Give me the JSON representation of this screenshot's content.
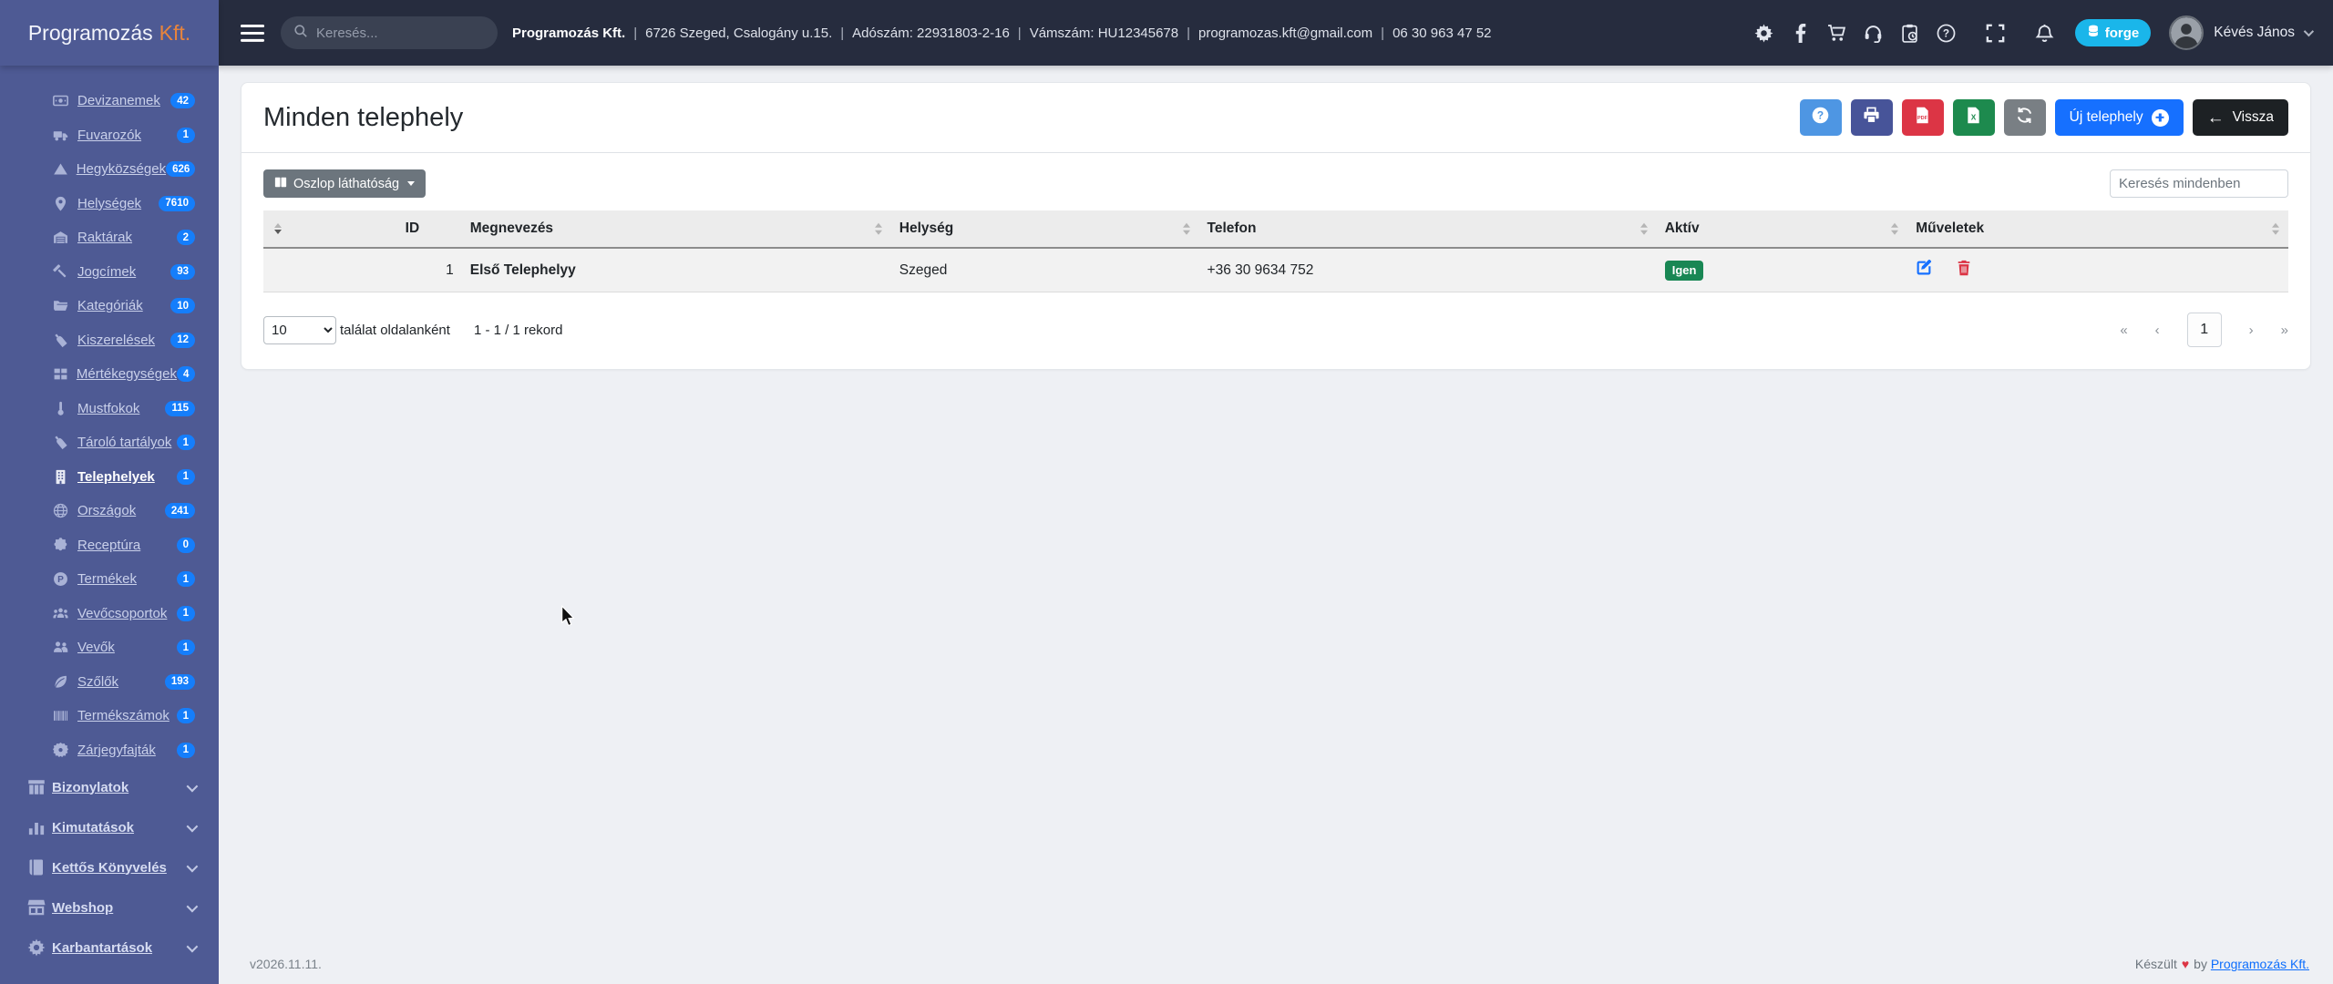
{
  "colors": {
    "sidebar_bg": "#4e5a94",
    "navbar_bg": "#262c3e",
    "brand_orange": "#e8843c",
    "badge_blue": "#157efb",
    "forge_cyan": "#1ab6ea",
    "accent_blue": "#1670ff",
    "success_green": "#198754",
    "danger_red": "#dc3545"
  },
  "sidebar": {
    "brand_name": "Programozás",
    "brand_suffix": "Kft.",
    "items": [
      {
        "label": "Devizanemek",
        "badge": "42",
        "icon": "banknote-icon"
      },
      {
        "label": "Fuvarozók",
        "badge": "1",
        "icon": "truck-icon"
      },
      {
        "label": "Hegyközségek",
        "badge": "626",
        "icon": "mountain-icon"
      },
      {
        "label": "Helységek",
        "badge": "7610",
        "icon": "map-pin-icon"
      },
      {
        "label": "Raktárak",
        "badge": "2",
        "icon": "warehouse-icon"
      },
      {
        "label": "Jogcímek",
        "badge": "93",
        "icon": "gavel-icon"
      },
      {
        "label": "Kategóriák",
        "badge": "10",
        "icon": "folder-icon"
      },
      {
        "label": "Kiszerelések",
        "badge": "12",
        "icon": "bottle-icon"
      },
      {
        "label": "Mértékegységek",
        "badge": "4",
        "icon": "grid-icon"
      },
      {
        "label": "Mustfokok",
        "badge": "115",
        "icon": "thermometer-icon"
      },
      {
        "label": "Tároló tartályok",
        "badge": "1",
        "icon": "tank-icon"
      },
      {
        "label": "Telephelyek",
        "badge": "1",
        "icon": "building-icon",
        "active": true
      },
      {
        "label": "Országok",
        "badge": "241",
        "icon": "globe-icon"
      },
      {
        "label": "Receptúra",
        "badge": "0",
        "icon": "puzzle-icon"
      },
      {
        "label": "Termékek",
        "badge": "1",
        "icon": "product-icon"
      },
      {
        "label": "Vevőcsoportok",
        "badge": "1",
        "icon": "users-group-icon"
      },
      {
        "label": "Vevők",
        "badge": "1",
        "icon": "users-icon"
      },
      {
        "label": "Szőlők",
        "badge": "193",
        "icon": "leaf-icon"
      },
      {
        "label": "Termékszámok",
        "badge": "1",
        "icon": "barcode-icon"
      },
      {
        "label": "Zárjegyfajták",
        "badge": "1",
        "icon": "seal-icon"
      }
    ],
    "groups": [
      {
        "label": "Bizonylatok",
        "icon": "columns-box-icon"
      },
      {
        "label": "Kimutatások",
        "icon": "bar-chart-icon"
      },
      {
        "label": "Kettős Könyvelés",
        "icon": "book-icon"
      },
      {
        "label": "Webshop",
        "icon": "shop-icon"
      },
      {
        "label": "Karbantartások",
        "icon": "gear-side-icon"
      }
    ]
  },
  "navbar": {
    "search_placeholder": "Keresés...",
    "company_name": "Programozás Kft.",
    "company_info": [
      "6726 Szeged, Csalogány u.15.",
      "Adószám: 22931803-2-16",
      "Vámszám: HU12345678",
      "programozas.kft@gmail.com",
      "06 30 963 47 52"
    ],
    "icons": [
      "gear-icon",
      "facebook-icon",
      "cart-icon",
      "headset-icon",
      "clipboard-clock-icon",
      "help-circle-icon",
      "fullscreen-icon",
      "bell-icon"
    ],
    "forge_label": "forge",
    "user_name": "Kévés János"
  },
  "page": {
    "title": "Minden telephely",
    "column_visibility_label": "Oszlop láthatóság",
    "new_button_label": "Új telephely",
    "back_button_label": "Vissza",
    "back_arrow": "←",
    "search_placeholder": "Keresés mindenben",
    "action_icons": [
      "help-icon",
      "printer-icon",
      "pdf-file-icon",
      "excel-file-icon",
      "refresh-icon"
    ]
  },
  "table": {
    "columns": [
      "ID",
      "Megnevezés",
      "Helység",
      "Telefon",
      "Aktív",
      "Műveletek"
    ],
    "row": {
      "id": "1",
      "name": "Első Telephelyy",
      "city": "Szeged",
      "phone": "+36 30 9634 752",
      "active": "Igen"
    }
  },
  "pagination": {
    "page_size": "10",
    "per_page_label": "találat oldalanként",
    "records_label": "1 - 1 / 1 rekord",
    "first": "«",
    "prev": "‹",
    "page": "1",
    "next": "›",
    "last": "»"
  },
  "footer": {
    "version": "v2026.11.11.",
    "made_label": "Készült",
    "heart": "♥",
    "by_label": "by",
    "company_link": "Programozás Kft."
  }
}
